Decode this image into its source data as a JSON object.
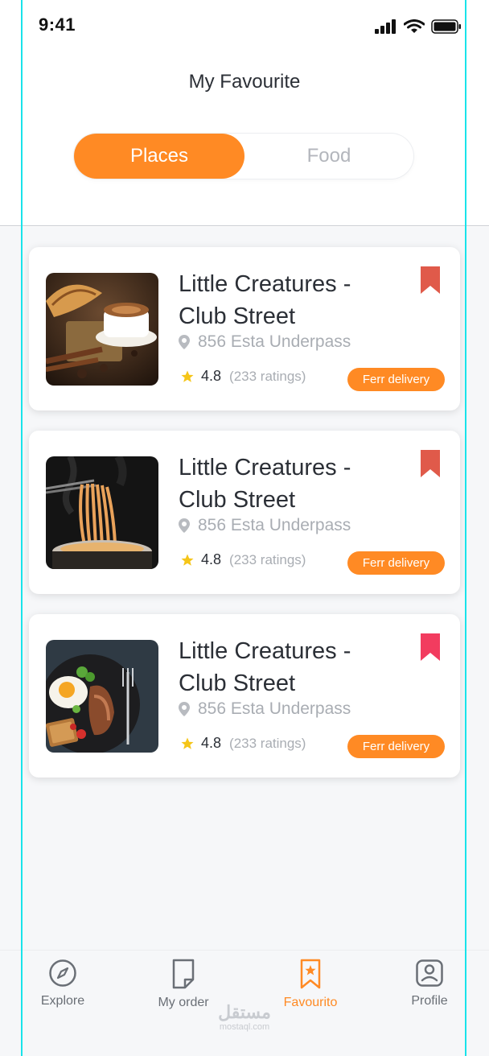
{
  "status_bar": {
    "time": "9:41"
  },
  "header": {
    "title": "My Favourite"
  },
  "tabs": [
    {
      "label": "Places",
      "active": true
    },
    {
      "label": "Food",
      "active": false
    }
  ],
  "cards": [
    {
      "title": "Little Creatures - Club Street",
      "address": "856 Esta Underpass",
      "rating": "4.8",
      "rating_count": "(233 ratings)",
      "badge": "Ferr delivery",
      "image": "coffee-croissant-photo",
      "bookmark_color": "#e05a4a"
    },
    {
      "title": "Little Creatures - Club Street",
      "address": "856 Esta Underpass",
      "rating": "4.8",
      "rating_count": "(233 ratings)",
      "badge": "Ferr delivery",
      "image": "noodles-photo",
      "bookmark_color": "#e05a4a"
    },
    {
      "title": "Little Creatures - Club Street",
      "address": "856 Esta Underpass",
      "rating": "4.8",
      "rating_count": "(233 ratings)",
      "badge": "Ferr delivery",
      "image": "breakfast-plate-photo",
      "bookmark_color": "#f23c5f"
    }
  ],
  "nav": [
    {
      "label": "Explore",
      "icon": "compass-icon",
      "active": false
    },
    {
      "label": "My order",
      "icon": "receipt-icon",
      "active": false
    },
    {
      "label": "Favourito",
      "icon": "bookmark-star-icon",
      "active": true
    },
    {
      "label": "Profile",
      "icon": "profile-icon",
      "active": false
    }
  ],
  "watermark": {
    "arabic": "مستقل",
    "latin": "mostaql.com"
  },
  "colors": {
    "accent": "#ff8a24",
    "star": "#f5c518",
    "guide": "#19e3ea"
  }
}
